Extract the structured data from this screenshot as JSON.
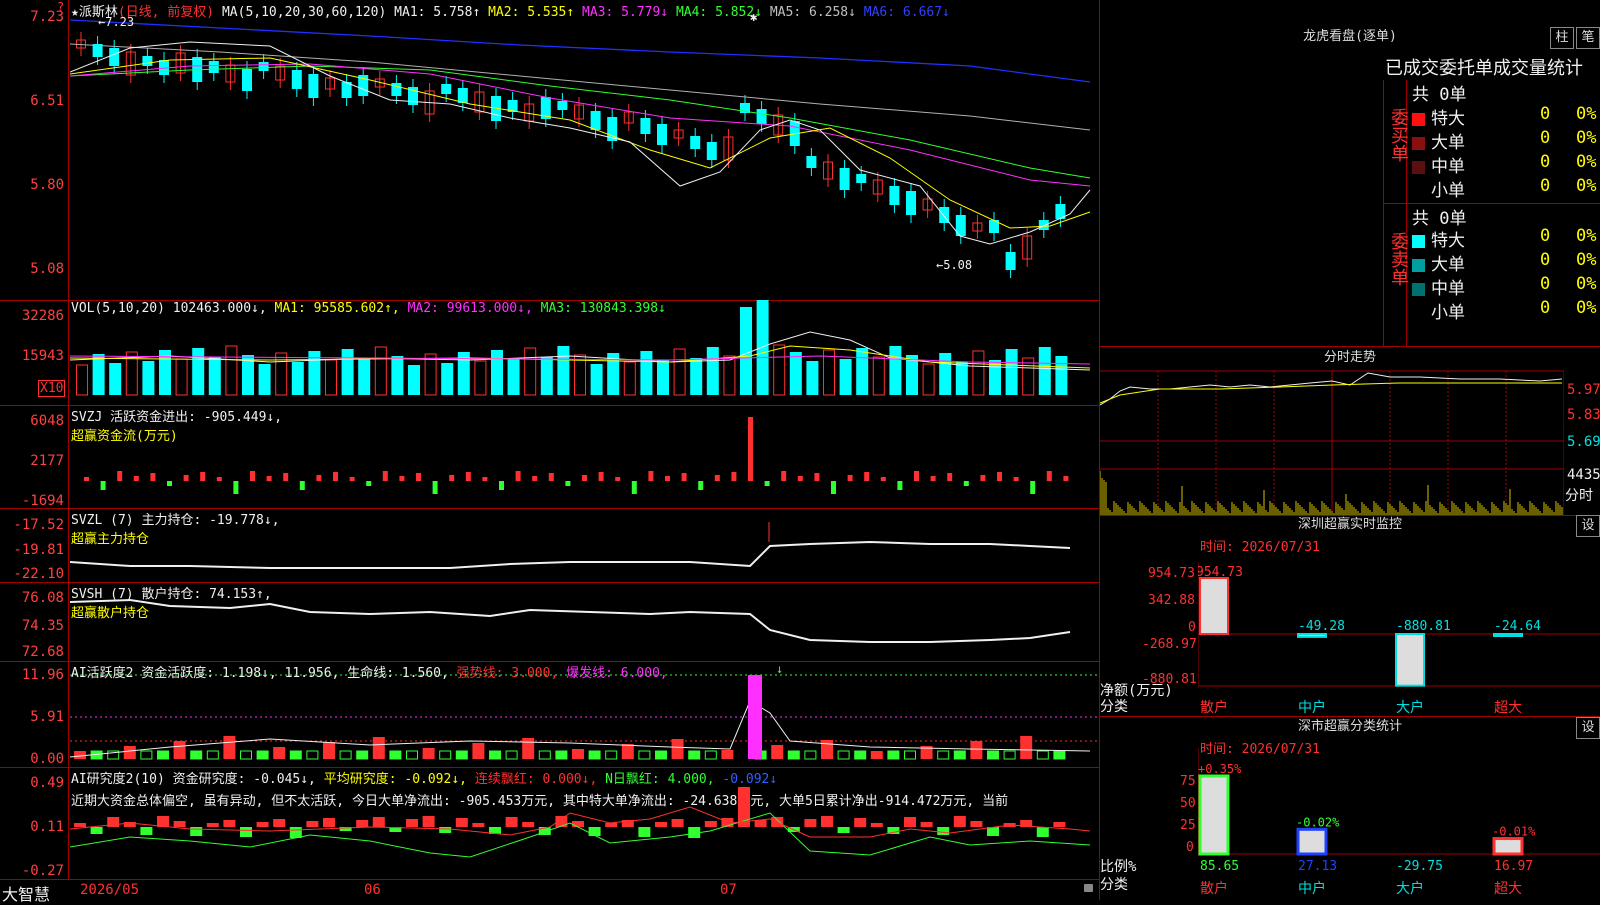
{
  "kline": {
    "ma_hint": "MA(5,10,20,30,60,120)",
    "ma": [
      {
        "label": "MA1: 5.758↑",
        "color": "#f0f0f0"
      },
      {
        "label": "MA2: 5.535↑",
        "color": "#ffff00"
      },
      {
        "label": "MA3: 5.779↓",
        "color": "#ff30ff"
      },
      {
        "label": "MA4: 5.852↓",
        "color": "#30ff30"
      },
      {
        "label": "MA5: 6.258↓",
        "color": "#c0c0c0"
      },
      {
        "label": "MA6: 6.667↓",
        "color": "#3040ff"
      }
    ],
    "star_name": "★派斯林",
    "mode": "(日线, 前复权)",
    "high_mark": "7.23",
    "low_mark": "5.08",
    "ticks": [
      "7.23",
      "6.51",
      "5.80",
      "5.08"
    ]
  },
  "vol": {
    "label": "VOL(5,10,20)",
    "value": "102463.000↓,",
    "ma1": "MA1: 95585.602↑,",
    "ma2": "MA2: 99613.000↓,",
    "ma3": "MA3: 130843.398↓",
    "ticks": [
      "32286",
      "15943"
    ],
    "unit": "X10"
  },
  "svzj": {
    "line1": "SVZJ  活跃资金进出: -905.449↓,",
    "line2": "超赢资金流(万元)",
    "ticks": [
      "6048",
      "2177",
      "-1694"
    ]
  },
  "svzl": {
    "line1": "SVZL (7) 主力持仓: -19.778↓,",
    "line2": "超赢主力持仓",
    "ticks": [
      "-17.52",
      "-19.81",
      "-22.10"
    ]
  },
  "svsh": {
    "line1": "SVSH (7) 散户持仓: 74.153↑,",
    "line2": "超赢散户持仓",
    "ticks": [
      "76.08",
      "74.35",
      "72.68"
    ]
  },
  "ai1": {
    "p1": "AI活跃度2 资金活跃度: 1.198↓,",
    "p2": "11.956,",
    "p3": "生命线: 1.560,",
    "p4": "强势线: 3.000,",
    "p5": "爆发线: 6.000,",
    "ticks": [
      "11.96",
      "5.91",
      "0.00"
    ]
  },
  "ai2": {
    "p1": "AI研究度2(10) 资金研究度: -0.045↓,",
    "p2": "平均研究度: -0.092↓,",
    "p3": "连续飘红: 0.000↓,",
    "p4": "N日飘红: 4.000,",
    "p5": "-0.092↓",
    "comment": "近期大资金总体偏空, 虽有异动, 但不太活跃, 今日大单净流出: -905.453万元, 其中特大单净流出: -24.638万元, 大单5日累计净出-914.472万元, 当前",
    "ticks": [
      "0.49",
      "0.11",
      "-0.27"
    ]
  },
  "footer": {
    "brand": "大智慧",
    "months": [
      "2026/05",
      "06",
      "07"
    ]
  },
  "lhb": {
    "title": "龙虎看盘(逐单)",
    "btn1": "柱",
    "btn2": "笔",
    "tabs": "已成交委托单成交量统计",
    "buy_side": "委买单",
    "sell_side": "委卖单",
    "buy_total": "共 0单",
    "sell_total": "共 0单",
    "buy_rows": [
      {
        "name": "特大",
        "count": "0",
        "pct": "0%",
        "color": "#ff1010"
      },
      {
        "name": "大单",
        "count": "0",
        "pct": "0%",
        "color": "#8a1010"
      },
      {
        "name": "中单",
        "count": "0",
        "pct": "0%",
        "color": "#5a1010"
      },
      {
        "name": "小单",
        "count": "0",
        "pct": "0%",
        "color": "#000000"
      }
    ],
    "sell_rows": [
      {
        "name": "特大",
        "count": "0",
        "pct": "0%",
        "color": "#00ffff"
      },
      {
        "name": "大单",
        "count": "0",
        "pct": "0%",
        "color": "#00a0a0"
      },
      {
        "name": "中单",
        "count": "0",
        "pct": "0%",
        "color": "#007070"
      },
      {
        "name": "小单",
        "count": "0",
        "pct": "0%",
        "color": "#000000"
      }
    ]
  },
  "fenshi": {
    "title": "分时走势",
    "ticks": [
      "5.97",
      "5.83",
      "5.69"
    ],
    "vol_tick": "4435",
    "vol_label": "分时"
  },
  "szmon": {
    "title": "深圳超赢实时监控",
    "btn": "设",
    "time": "时间: 2026/07/31",
    "ticks": [
      "954.73",
      "342.88",
      "0",
      "-268.97",
      "-880.81"
    ],
    "ylabel": "净额(万元)",
    "xlabel": "分类",
    "bars": [
      {
        "name": "散户",
        "value": 954.73,
        "label": "954.73"
      },
      {
        "name": "中户",
        "value": -49.28,
        "label": "-49.28"
      },
      {
        "name": "大户",
        "value": -880.81,
        "label": "-880.81"
      },
      {
        "name": "超大",
        "value": -24.64,
        "label": "-24.64"
      }
    ]
  },
  "szcls": {
    "title": "深市超赢分类统计",
    "btn": "设",
    "time": "时间: 2026/07/31",
    "ticks": [
      "75",
      "50",
      "25",
      "0"
    ],
    "ylabel": "比例%",
    "xlabel": "分类",
    "bars": [
      {
        "name": "散户",
        "value": 85.65,
        "change": "+0.35%",
        "color": "#30ff30"
      },
      {
        "name": "中户",
        "value": 27.13,
        "change": "-0.02%",
        "color": "#2040ff"
      },
      {
        "name": "大户",
        "value": -29.75,
        "change": "",
        "color": "#00e0e0"
      },
      {
        "name": "超大",
        "value": 16.97,
        "change": "-0.01%",
        "color": "#ff3030"
      }
    ],
    "values": [
      "85.65",
      "27.13",
      "-29.75",
      "16.97"
    ]
  }
}
